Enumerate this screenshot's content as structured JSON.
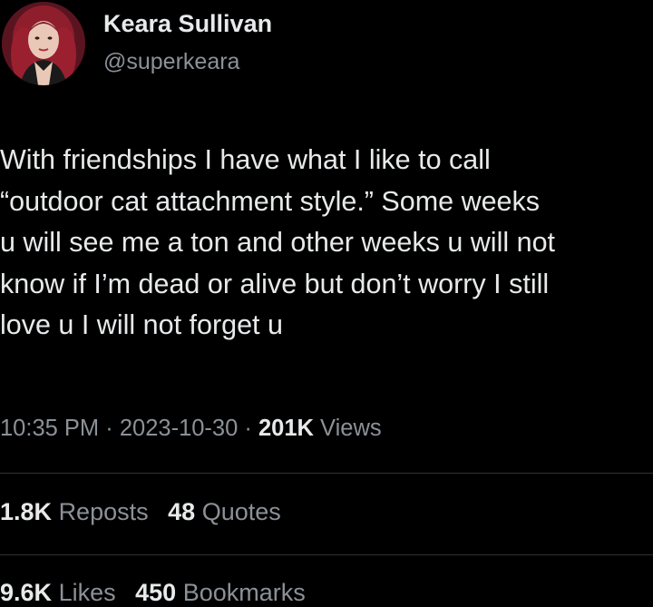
{
  "author": {
    "display_name": "Keara Sullivan",
    "handle": "@superkeara",
    "avatar_icon": "profile-photo-avatar"
  },
  "tweet": {
    "lines": [
      "With friendships I have what I like to call",
      "“outdoor cat attachment style.” Some weeks",
      "u will see me a ton and other weeks u will not",
      "know if I’m dead or alive but don’t worry I still",
      "love u I will not forget u"
    ]
  },
  "meta": {
    "time": "10:35 PM",
    "separator": "·",
    "date": "2023-10-30",
    "views_count": "201K",
    "views_label": "Views"
  },
  "stats": {
    "reposts_count": "1.8K",
    "reposts_label": "Reposts",
    "quotes_count": "48",
    "quotes_label": "Quotes",
    "likes_count": "9.6K",
    "likes_label": "Likes",
    "bookmarks_count": "450",
    "bookmarks_label": "Bookmarks"
  },
  "colors": {
    "background": "#000000",
    "primary_text": "#e7e9ea",
    "secondary_text": "#8b9197",
    "divider": "#2f3336"
  }
}
